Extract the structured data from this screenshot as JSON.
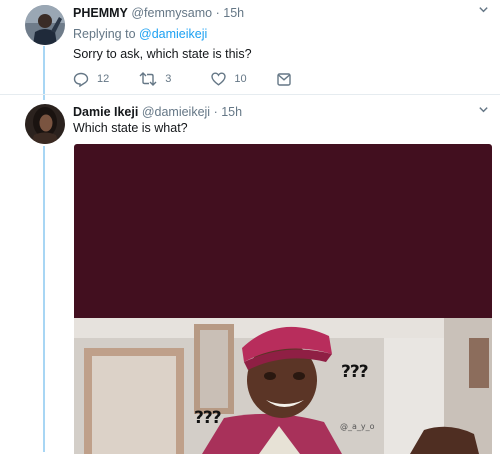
{
  "tweets": [
    {
      "author_name": "PHEMMY",
      "author_handle": "@femmysamo",
      "separator": "·",
      "time": "15h",
      "replying_prefix": "Replying to ",
      "replying_to": "@damieikeji",
      "text": "Sorry to ask, which state is this?",
      "reply_count": "12",
      "retweet_count": "3",
      "like_count": "10",
      "caret": "⌄"
    },
    {
      "author_name": "Damie Ikeji",
      "author_handle": "@damieikeji",
      "separator": "·",
      "time": "15h",
      "text": "Which state is what?",
      "caret": "⌄",
      "media": {
        "meme_left": "???",
        "meme_right": "???",
        "watermark": "@_a_y_o"
      }
    }
  ],
  "colors": {
    "accent": "#1da1f2",
    "thread_line": "#a8d6f4",
    "muted": "#657786",
    "media_top": "#420f1f"
  },
  "icons": [
    "reply-icon",
    "retweet-icon",
    "like-icon",
    "direct-message-icon",
    "chevron-down-icon"
  ]
}
